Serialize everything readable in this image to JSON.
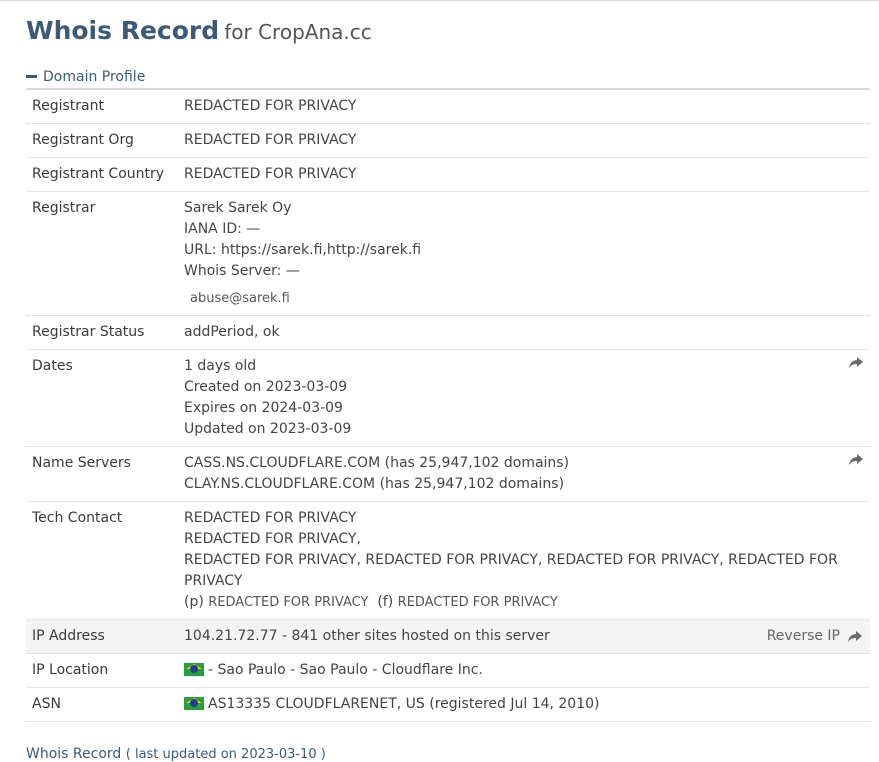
{
  "header": {
    "title": "Whois Record",
    "for_text": "for CropAna.cc"
  },
  "section": {
    "label": "Domain Profile"
  },
  "registrant": {
    "label": "Registrant",
    "value": "REDACTED FOR PRIVACY"
  },
  "registrant_org": {
    "label": "Registrant Org",
    "value": "REDACTED FOR PRIVACY"
  },
  "registrant_country": {
    "label": "Registrant Country",
    "value": "REDACTED FOR PRIVACY"
  },
  "registrar": {
    "label": "Registrar",
    "name": "Sarek Sarek Oy",
    "iana": "IANA ID: —",
    "url": "URL: https://sarek.fi,http://sarek.fi",
    "whois_server": "Whois Server: —",
    "email": "abuse@sarek.fi"
  },
  "registrar_status": {
    "label": "Registrar Status",
    "value": "addPeriod, ok"
  },
  "dates": {
    "label": "Dates",
    "age": "1 days old",
    "created": "Created on 2023-03-09",
    "expires": "Expires on 2024-03-09",
    "updated": "Updated on 2023-03-09"
  },
  "name_servers": {
    "label": "Name Servers",
    "ns1": "CASS.NS.CLOUDFLARE.COM (has 25,947,102 domains)",
    "ns2": "CLAY.NS.CLOUDFLARE.COM (has 25,947,102 domains)"
  },
  "tech_contact": {
    "label": "Tech Contact",
    "line1": "REDACTED FOR PRIVACY",
    "line2": "REDACTED FOR PRIVACY,",
    "line3": "REDACTED FOR PRIVACY, REDACTED FOR PRIVACY, REDACTED FOR PRIVACY, REDACTED FOR PRIVACY",
    "phone_prefix": "(p)",
    "phone": "REDACTED FOR PRIVACY",
    "fax_prefix": "(f)",
    "fax": "REDACTED FOR PRIVACY"
  },
  "ip_address": {
    "label": "IP Address",
    "value": "104.21.72.77 - 841 other sites hosted on this server",
    "reverse_label": "Reverse IP"
  },
  "ip_location": {
    "label": "IP Location",
    "value": "- Sao Paulo - Sao Paulo - Cloudflare Inc."
  },
  "asn": {
    "label": "ASN",
    "value": "AS13335 CLOUDFLARENET, US (registered Jul 14, 2010)"
  },
  "footer": {
    "link": "Whois Record",
    "note": "( last updated on 2023-03-10 )"
  },
  "icons": {
    "share": "share-arrow-icon",
    "collapse": "minus-icon",
    "flag": "brazil-flag-icon"
  },
  "colors": {
    "heading": "#3c5a78",
    "shaded_row": "#f3f3f3"
  }
}
